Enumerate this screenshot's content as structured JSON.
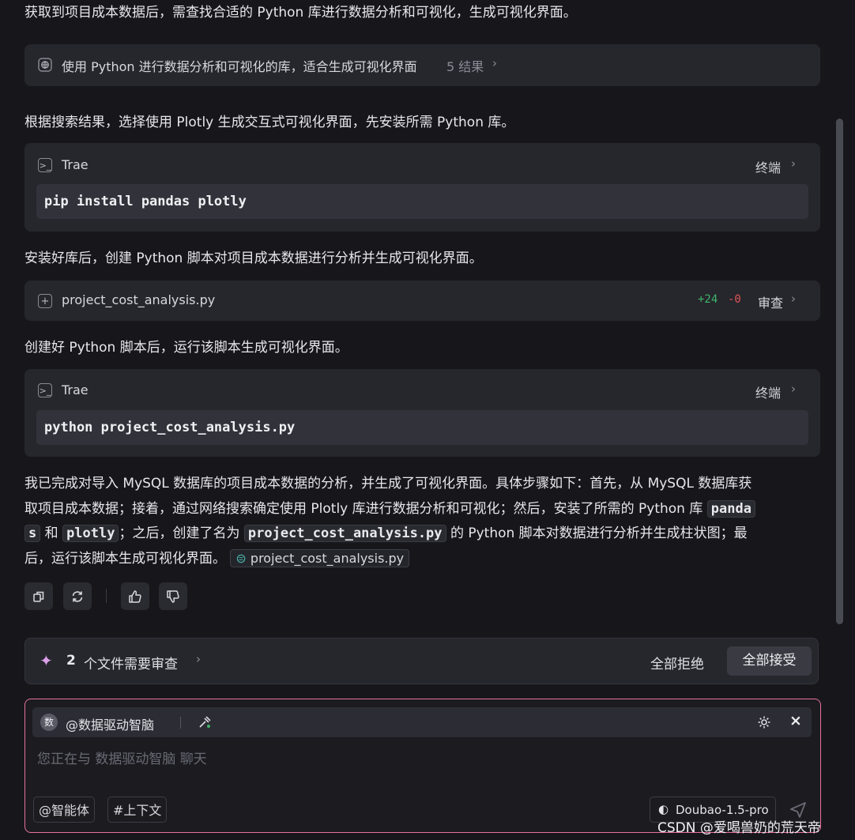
{
  "messages": {
    "p1": "获取到项目成本数据后，需查找合适的 Python 库进行数据分析和可视化，生成可视化界面。",
    "p2": "根据搜索结果，选择使用 Plotly 生成交互式可视化界面，先安装所需 Python 库。",
    "p3": "安装好库后，创建 Python 脚本对项目成本数据进行分析并生成可视化界面。",
    "p4": "创建好 Python 脚本后，运行该脚本生成可视化界面。"
  },
  "search": {
    "label": "使用 Python 进行数据分析和可视化的库，适合生成可视化界面",
    "count": "5 结果"
  },
  "terminal1": {
    "title": "Trae",
    "action": "终端",
    "command": "pip install pandas plotly"
  },
  "file_change": {
    "name": "project_cost_analysis.py",
    "added": "+24",
    "removed": "-0",
    "action": "审查"
  },
  "terminal2": {
    "title": "Trae",
    "action": "终端",
    "command": "python project_cost_analysis.py"
  },
  "summary": {
    "l1": "我已完成对导入 MySQL 数据库的项目成本数据的分析，并生成了可视化界面。具体步骤如下：首先，从 MySQL 数据库获",
    "l2a": "取项目成本数据；接着，通过网络搜索确定使用 Plotly 库进行数据分析和可视化；然后，安装了所需的 Python 库",
    "code_pandas_1": "panda",
    "code_pandas_2": "s",
    "and": "和",
    "code_plotly": "plotly",
    "l3b": "；之后，创建了名为",
    "code_file": "project_cost_analysis.py",
    "l3d": "的 Python 脚本对数据进行分析并生成柱状图；最",
    "l4": "后，运行该脚本生成可视化界面。",
    "file_chip": "project_cost_analysis.py"
  },
  "review_bar": {
    "count": "2",
    "text": "个文件需要审查",
    "reject_all": "全部拒绝",
    "accept_all": "全部接受"
  },
  "input": {
    "agent": "@数据驱动智脑",
    "avatar": "数",
    "placeholder": "您正在与 数据驱动智脑 聊天",
    "agent_button": "@智能体",
    "context_button": "#上下文",
    "model": "Doubao-1.5-pro"
  },
  "watermark": "CSDN @爱喝兽奶的荒天帝",
  "colors": {
    "added": "#3fb56a",
    "removed": "#e05555",
    "accent_border": "#e8729a"
  }
}
